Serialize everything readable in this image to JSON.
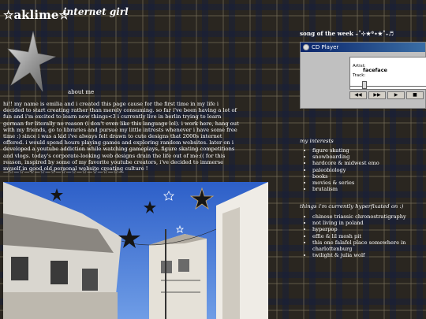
{
  "header": {
    "title": "☆aklime☆",
    "subtitle": "internet girl"
  },
  "about": {
    "label": "about me",
    "text": "hi!! my name is emilia and i created this page cause for the first time in my life i decided to start creating rather than merely consuming. so far i've been having a lot of fun and i'm excited to learn new things<3 i currently live in berlin trying to learn german for literally no reason (i don't even like this language lol). i work here, hang out with my friends, go to libraries and pursue my little intrests whenever i have some free time :) since i was a kid i've always felt drawn to cute designs that 2000s internet offered. i would spend hours playing games and exploring random websites. later on i developed a youtube addiction while watching gameplays, figure skating competitions and vlogs. today's corporate-looking web designs drain the life out of me:(( for this reason, inspired by some of my favorite youtube creators, i've decided to immerse myself in good old personal website creating culture !",
    "divider": "—☆—☆—☆—☆—☆—☆—☆—☆—☆—☆—☆—"
  },
  "song": {
    "heading": "song of the week ₊˚⊹★꙳⋆★˚₊♬",
    "player": {
      "window_title": "CD Player",
      "artist_label": "Artist:",
      "track_label": "Track:",
      "track_value": "faceface",
      "buttons": [
        "◀◀",
        "▶▶",
        "▶",
        "■"
      ]
    }
  },
  "interests": {
    "heading": "my interests",
    "items": [
      "figure skating",
      "snowboarding",
      "hardcore & midwest emo",
      "paleobiology",
      "books",
      "movies & series",
      "brutalism"
    ]
  },
  "hyperfixations": {
    "heading": "things i'm currently hyperfixated on :)",
    "items": [
      "chinese triassic chronostratigraphy",
      "not living in poland",
      "hyperpop",
      "effie & lil mosh pit",
      "this one falafel place somewhere in charlottenburg",
      "twilight & julia wolf"
    ]
  },
  "colors": {
    "text": "#ffffff",
    "plaid_dark": "#2a2620",
    "sky": "#3f6fd0"
  }
}
